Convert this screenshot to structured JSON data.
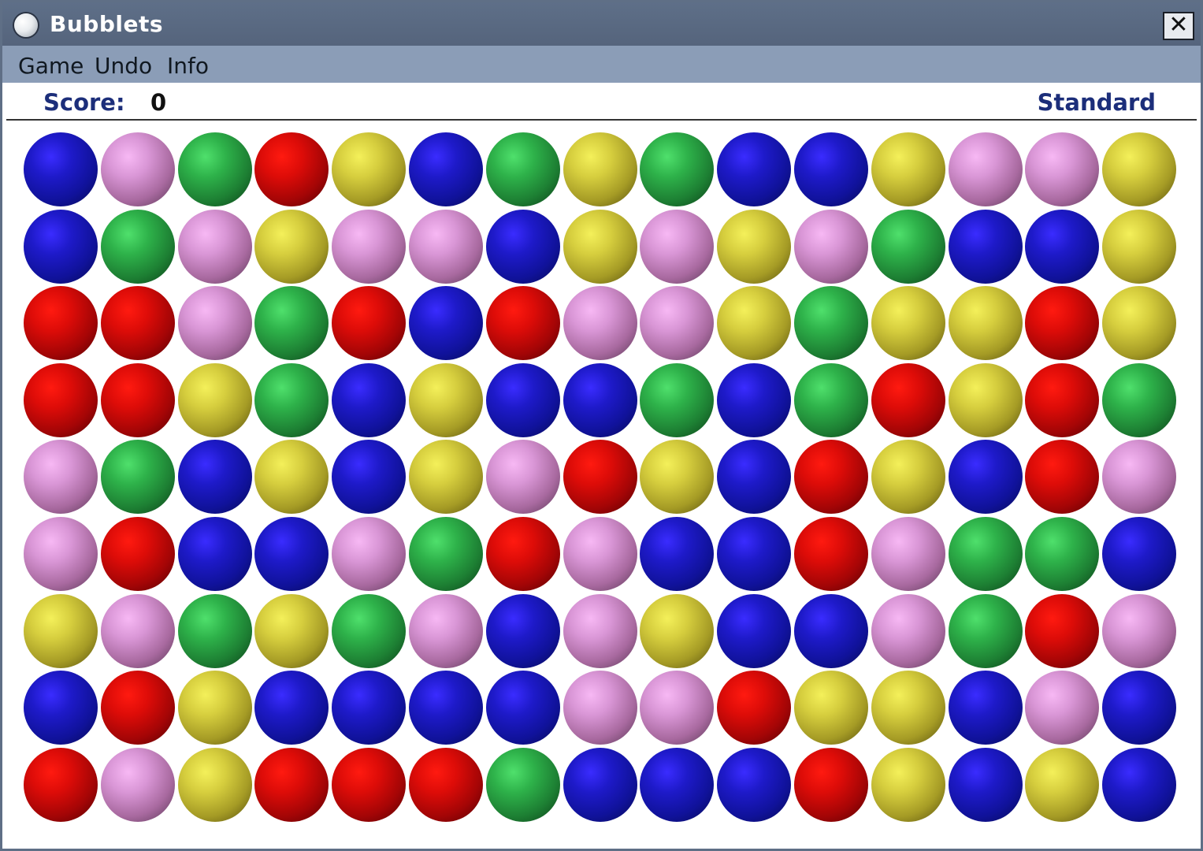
{
  "window": {
    "title": "Bubblets",
    "close_label": "✕"
  },
  "menu": {
    "items": [
      "Game",
      "Undo",
      "Info"
    ]
  },
  "status": {
    "score_label": "Score:",
    "score_value": "0",
    "mode": "Standard"
  },
  "colors": {
    "blue": "#1e1ac9",
    "red": "#dd0c08",
    "green": "#2eb24a",
    "yellow": "#d6ce3e",
    "pink": "#d996d6"
  },
  "board": {
    "rows": 9,
    "cols": 15,
    "grid": [
      [
        "blue",
        "pink",
        "green",
        "red",
        "yellow",
        "blue",
        "green",
        "yellow",
        "green",
        "blue",
        "blue",
        "yellow",
        "pink",
        "pink",
        "yellow"
      ],
      [
        "blue",
        "green",
        "pink",
        "yellow",
        "pink",
        "pink",
        "blue",
        "yellow",
        "pink",
        "yellow",
        "pink",
        "green",
        "blue",
        "blue",
        "yellow"
      ],
      [
        "red",
        "red",
        "pink",
        "green",
        "red",
        "blue",
        "red",
        "pink",
        "pink",
        "yellow",
        "green",
        "yellow",
        "yellow",
        "red",
        "yellow"
      ],
      [
        "red",
        "red",
        "yellow",
        "green",
        "blue",
        "yellow",
        "blue",
        "blue",
        "green",
        "blue",
        "green",
        "red",
        "yellow",
        "red",
        "green"
      ],
      [
        "pink",
        "green",
        "blue",
        "yellow",
        "blue",
        "yellow",
        "pink",
        "red",
        "yellow",
        "blue",
        "red",
        "yellow",
        "blue",
        "red",
        "pink"
      ],
      [
        "pink",
        "red",
        "blue",
        "blue",
        "pink",
        "green",
        "red",
        "pink",
        "blue",
        "blue",
        "red",
        "pink",
        "green",
        "green",
        "blue"
      ],
      [
        "yellow",
        "pink",
        "green",
        "yellow",
        "green",
        "pink",
        "blue",
        "pink",
        "yellow",
        "blue",
        "blue",
        "pink",
        "green",
        "red",
        "pink"
      ],
      [
        "blue",
        "red",
        "yellow",
        "blue",
        "blue",
        "blue",
        "blue",
        "pink",
        "pink",
        "red",
        "yellow",
        "yellow",
        "blue",
        "pink",
        "blue"
      ],
      [
        "red",
        "pink",
        "yellow",
        "red",
        "red",
        "red",
        "green",
        "blue",
        "blue",
        "blue",
        "red",
        "yellow",
        "blue",
        "yellow",
        "blue"
      ]
    ]
  }
}
